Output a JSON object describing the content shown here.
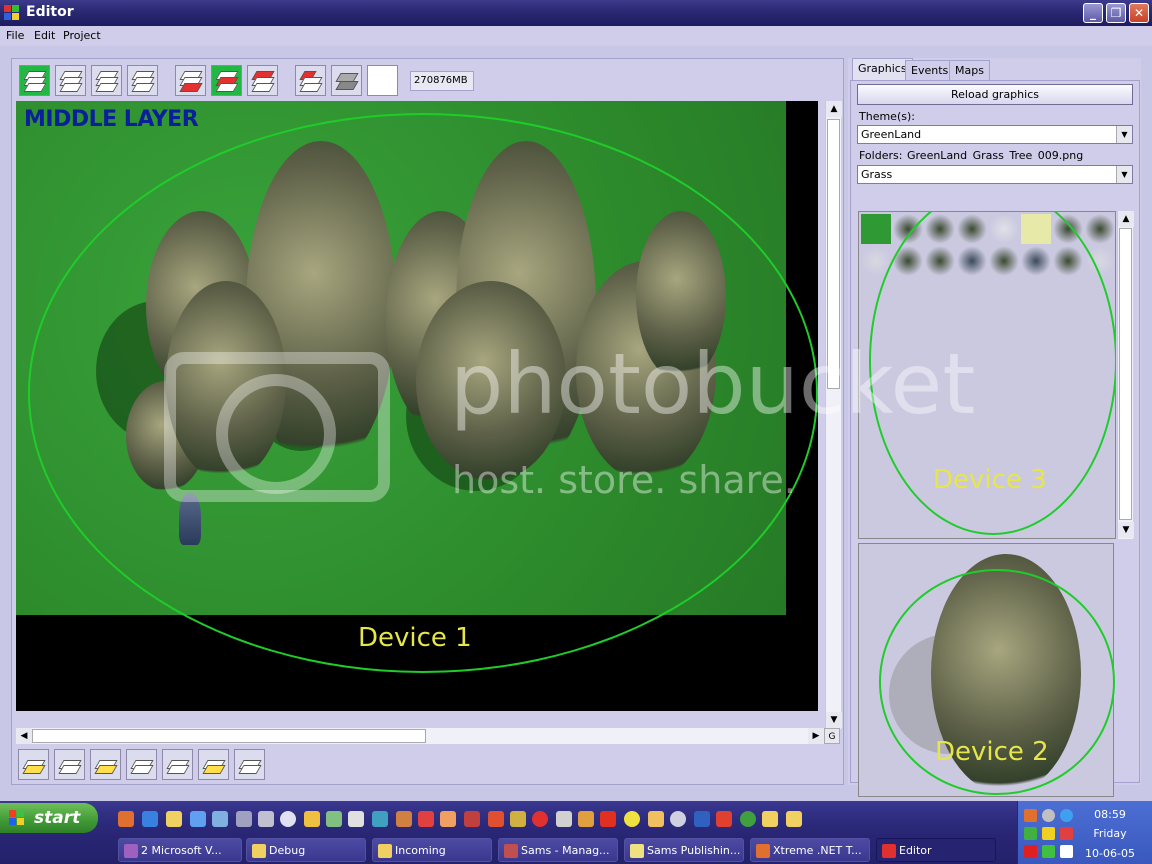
{
  "window": {
    "title": "Editor",
    "min": "_",
    "max": "❐",
    "close": "✕"
  },
  "menu": [
    "File",
    "Edit",
    "Project"
  ],
  "toolbar": {
    "memory": "270876MB"
  },
  "viewport": {
    "layer_label": "MIDDLE LAYER",
    "device_label": "Device 1"
  },
  "hscroll": {
    "corner": "G"
  },
  "tabs": [
    "Graphics",
    "Events",
    "Maps"
  ],
  "graphics": {
    "reload_label": "Reload graphics",
    "themes_label": "Theme(s):",
    "theme_value": "GreenLand",
    "folders_label": "Folders:",
    "folders_path": "GreenLand  Grass  Tree  009.png",
    "folder_value": "Grass",
    "gallery_device": "Device 3",
    "preview_device": "Device 2"
  },
  "watermark": {
    "line1": "photobucket",
    "line2": "host. store. share."
  },
  "taskbar": {
    "start": "start",
    "tasks": [
      "2 Microsoft V...",
      "Debug",
      "Incoming",
      "Sams - Manag...",
      "Sams Publishin...",
      "Xtreme .NET T...",
      "Editor"
    ],
    "clock_time": "08:59",
    "clock_day": "Friday",
    "clock_date": "10-06-05"
  },
  "colors": {
    "accent_green": "#1fcc2a",
    "device_text": "#e6e64a",
    "layer_label": "#0a1f9a"
  }
}
